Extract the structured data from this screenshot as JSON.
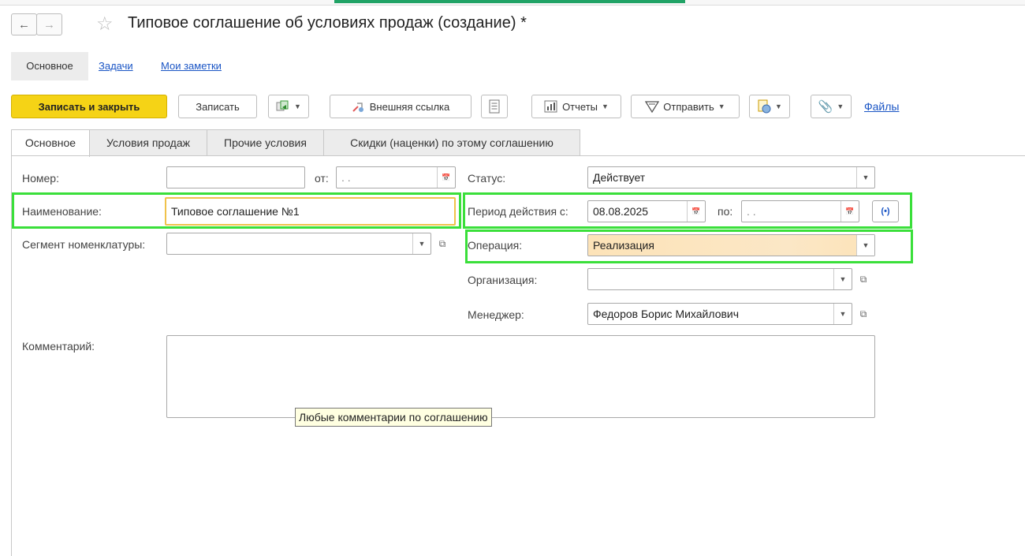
{
  "window": {
    "title": "Типовое соглашение об условиях продаж (создание) *",
    "back_icon": "arrow-left-icon",
    "forward_icon": "arrow-right-icon",
    "favorite_icon": "star-icon"
  },
  "subnav": {
    "items": [
      "Основное",
      "Задачи",
      "Мои заметки"
    ]
  },
  "toolbar": {
    "save_close_label": "Записать и закрыть",
    "save_label": "Записать",
    "external_link_label": "Внешняя ссылка",
    "reports_label": "Отчеты",
    "send_label": "Отправить",
    "files_label": "Файлы"
  },
  "tabs": [
    "Основное",
    "Условия продаж",
    "Прочие условия",
    "Скидки (наценки) по этому соглашению"
  ],
  "form": {
    "number_label": "Номер:",
    "number_value": "",
    "date_from_label": "от:",
    "date_from_value": ". .",
    "name_label": "Наименование:",
    "name_value": "Типовое соглашение №1",
    "segment_label": "Сегмент номенклатуры:",
    "segment_value": "",
    "status_label": "Статус:",
    "status_value": "Действует",
    "period_label": "Период действия с:",
    "period_from_value": "08.08.2025",
    "period_to_label": "по:",
    "period_to_value": ". .",
    "operation_label": "Операция:",
    "operation_value": "Реализация",
    "org_label": "Организация:",
    "org_value": "",
    "manager_label": "Менеджер:",
    "manager_value": "Федоров Борис Михайлович",
    "comment_label": "Комментарий:",
    "comment_value": "",
    "comment_tooltip": "Любые комментарии по соглашению"
  },
  "colors": {
    "primary_button": "#f5d316",
    "highlight": "#3adf3a",
    "operation_fill": "#fde3b8",
    "link": "#1a55c5"
  }
}
